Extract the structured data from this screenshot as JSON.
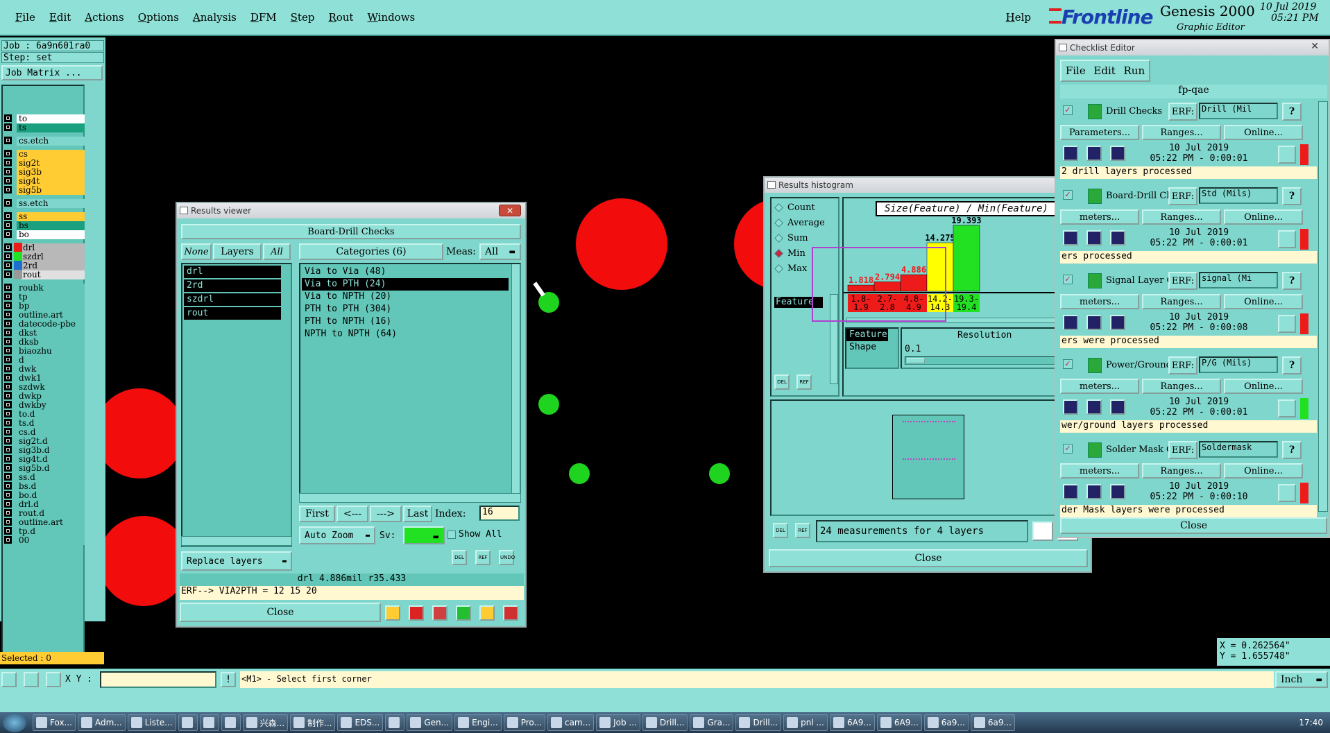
{
  "menubar": {
    "items": [
      "File",
      "Edit",
      "Actions",
      "Options",
      "Analysis",
      "DFM",
      "Step",
      "Rout",
      "Windows"
    ],
    "help": "Help"
  },
  "branding": {
    "logo": "Frontline",
    "product": "Genesis 2000",
    "subtitle": "Graphic Editor",
    "date": "10 Jul 2019",
    "time": "05:21 PM"
  },
  "leftpanel": {
    "job": "Job : 6a9n601ra0",
    "step": "Step: set",
    "job_matrix": "Job Matrix ...",
    "selected": "Selected : 0",
    "layers": [
      {
        "name": "to",
        "color": "#ffffff"
      },
      {
        "name": "ts",
        "color": "#1aa07f"
      },
      {
        "name": "cs.etch",
        "color": "#7fd6cc"
      },
      {
        "name": "cs",
        "color": "#ffcc33"
      },
      {
        "name": "sig2t",
        "color": "#ffcc33"
      },
      {
        "name": "sig3b",
        "color": "#ffcc33"
      },
      {
        "name": "sig4t",
        "color": "#ffcc33"
      },
      {
        "name": "sig5b",
        "color": "#ffcc33"
      },
      {
        "name": "ss.etch",
        "color": "#7fd6cc"
      },
      {
        "name": "ss",
        "color": "#ffcc33"
      },
      {
        "name": "bs",
        "color": "#1aa07f"
      },
      {
        "name": "bo",
        "color": "#ffffff"
      },
      {
        "name": "drl",
        "color": "#b8b8b8"
      },
      {
        "name": "szdrl",
        "color": "#b8b8b8"
      },
      {
        "name": "2rd",
        "color": "#b8b8b8"
      },
      {
        "name": "rout",
        "color": "#e0e0e0"
      },
      {
        "name": "roubk",
        "color": "#62c7b8"
      },
      {
        "name": "tp",
        "color": "#62c7b8"
      },
      {
        "name": "bp",
        "color": "#62c7b8"
      },
      {
        "name": "outline.art",
        "color": "#62c7b8"
      },
      {
        "name": "datecode-pbe",
        "color": "#62c7b8"
      },
      {
        "name": "dkst",
        "color": "#62c7b8"
      },
      {
        "name": "dksb",
        "color": "#62c7b8"
      },
      {
        "name": "biaozhu",
        "color": "#62c7b8"
      },
      {
        "name": "d",
        "color": "#62c7b8"
      },
      {
        "name": "dwk",
        "color": "#62c7b8"
      },
      {
        "name": "dwk1",
        "color": "#62c7b8"
      },
      {
        "name": "szdwk",
        "color": "#62c7b8"
      },
      {
        "name": "dwkp",
        "color": "#62c7b8"
      },
      {
        "name": "dwkby",
        "color": "#62c7b8"
      },
      {
        "name": "to.d",
        "color": "#62c7b8"
      },
      {
        "name": "ts.d",
        "color": "#62c7b8"
      },
      {
        "name": "cs.d",
        "color": "#62c7b8"
      },
      {
        "name": "sig2t.d",
        "color": "#62c7b8"
      },
      {
        "name": "sig3b.d",
        "color": "#62c7b8"
      },
      {
        "name": "sig4t.d",
        "color": "#62c7b8"
      },
      {
        "name": "sig5b.d",
        "color": "#62c7b8"
      },
      {
        "name": "ss.d",
        "color": "#62c7b8"
      },
      {
        "name": "bs.d",
        "color": "#62c7b8"
      },
      {
        "name": "bo.d",
        "color": "#62c7b8"
      },
      {
        "name": "drl.d",
        "color": "#62c7b8"
      },
      {
        "name": "rout.d",
        "color": "#62c7b8"
      },
      {
        "name": "outline.art",
        "color": "#62c7b8"
      },
      {
        "name": "tp.d",
        "color": "#62c7b8"
      },
      {
        "name": "00",
        "color": "#62c7b8"
      }
    ]
  },
  "results_viewer": {
    "title": "Results viewer",
    "heading": "Board-Drill Checks",
    "btn_none": "None",
    "btn_layers": "Layers",
    "btn_all": "All",
    "categories_label": "Categories (6)",
    "meas_label": "Meas:",
    "meas_value": "All",
    "layers": [
      "drl",
      "2rd",
      "szdrl",
      "rout"
    ],
    "categories": [
      "Via to Via  (48)",
      "Via to PTH  (24)",
      "Via to NPTH  (20)",
      "PTH to PTH  (304)",
      "PTH to NPTH  (16)",
      "NPTH to NPTH  (64)"
    ],
    "nav_first": "First",
    "nav_prev": "<---",
    "nav_next": "--->",
    "nav_last": "Last",
    "index_label": "Index:",
    "index_value": "16",
    "auto_zoom": "Auto Zoom",
    "sv_label": "Sv:",
    "show_all": "Show All",
    "replace_layers": "Replace layers",
    "del": "DEL",
    "ref": "REF",
    "undo": "UNDO",
    "measurement": "drl  4.886mil  r35.433",
    "erf_line": "ERF--> VIA2PTH = 12 15 20",
    "close": "Close"
  },
  "histogram": {
    "title": "Results histogram",
    "options": [
      "Count",
      "Average",
      "Sum",
      "Min",
      "Max"
    ],
    "selected_option": "Min",
    "feature_label": "Feature",
    "chart_title": "Size(Feature) / Min(Feature)",
    "shape_list": [
      "Feature",
      "Shape"
    ],
    "resolution_label": "Resolution",
    "resolution_value": "0.1",
    "footer": "24 measurements for 4 layers",
    "close": "Close",
    "del": "DEL",
    "ref": "REF"
  },
  "chart_data": {
    "type": "bar",
    "title": "Size(Feature) / Min(Feature)",
    "categories": [
      "1.8-1.9",
      "2.7-2.8",
      "4.8-4.9",
      "14.2-14.3",
      "19.3-19.4"
    ],
    "values": [
      1.818,
      2.794,
      4.886,
      14.275,
      19.393
    ],
    "value_labels": [
      "1.818",
      "2.794",
      "4.886",
      "14.275",
      "19.393"
    ],
    "bin_labels": [
      [
        "1.8-",
        "1.9"
      ],
      [
        "2.7-",
        "2.8"
      ],
      [
        "4.8-",
        "4.9"
      ],
      [
        "14.2-",
        "14.3"
      ],
      [
        "19.3-",
        "19.4"
      ]
    ],
    "colors": [
      "#ee1b1b",
      "#ee1b1b",
      "#ee1b1b",
      "#ffff00",
      "#22e022"
    ],
    "label_colors": [
      "#ee1b1b",
      "#ee1b1b",
      "#ee1b1b",
      "#000000",
      "#000000"
    ],
    "ylim": [
      0,
      20
    ]
  },
  "checklist": {
    "title": "Checklist Editor",
    "menu": [
      "File",
      "Edit",
      "Run"
    ],
    "name": "fp-qae",
    "erf_label": "ERF:",
    "params": "Parameters...",
    "params_short": "meters...",
    "ranges": "Ranges...",
    "online": "Online...",
    "close": "Close",
    "items": [
      {
        "name": "Drill Checks",
        "erf": "Drill (Mil",
        "date": "10 Jul 2019",
        "time": "05:22 PM - 0:00:01",
        "status": "2 drill layers processed",
        "status_color": "#ee1b1b"
      },
      {
        "name": "Board-Drill Che",
        "erf": "Std (Mils)",
        "date": "10 Jul 2019",
        "time": "05:22 PM - 0:00:01",
        "status": "ers processed",
        "status_color": "#ee1b1b"
      },
      {
        "name": "Signal Layer Ch",
        "erf": "signal (Mi",
        "date": "10 Jul 2019",
        "time": "05:22 PM - 0:00:08",
        "status": "ers were processed",
        "status_color": "#ee1b1b"
      },
      {
        "name": "Power/Ground C",
        "erf": "P/G (Mils)",
        "date": "10 Jul 2019",
        "time": "05:22 PM - 0:00:01",
        "status": "wer/ground layers processed",
        "status_color": "#22e022"
      },
      {
        "name": "Solder Mask Ch",
        "erf": "Soldermask",
        "date": "10 Jul 2019",
        "time": "05:22 PM - 0:00:10",
        "status": "der Mask layers were processed",
        "status_color": "#ee1b1b"
      }
    ]
  },
  "coords": {
    "x": "X = 0.262564\"",
    "y": "Y = 1.655748\""
  },
  "bottombar": {
    "xy_label": "X Y :",
    "xy_value": "",
    "prompt": "<M1> - Select first corner",
    "units": "Inch"
  },
  "taskbar": {
    "tasks": [
      "Fox...",
      "Adm...",
      "Liste...",
      "",
      "",
      "",
      "兴森...",
      "制作...",
      "EDS...",
      "",
      "Gen...",
      "Engi...",
      "Pro...",
      "cam...",
      "Job ...",
      "Drill...",
      "Gra...",
      "Drill...",
      "pnl ...",
      "6A9...",
      "6A9...",
      "6a9...",
      "6a9..."
    ],
    "clock": "17:40"
  }
}
